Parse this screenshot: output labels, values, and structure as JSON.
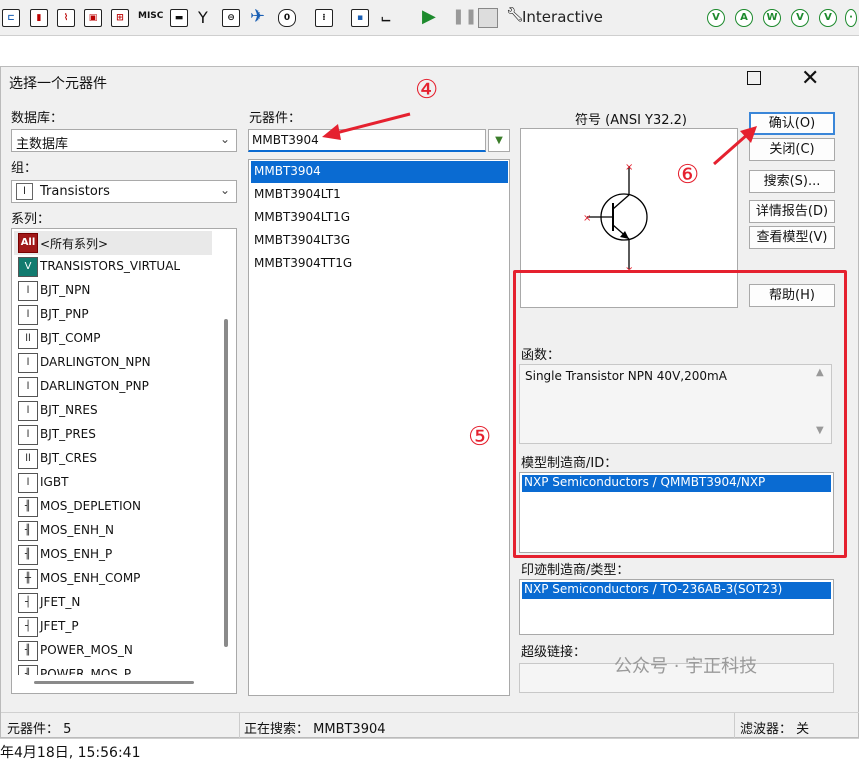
{
  "toolbar": {
    "icons": [
      "switch-icon",
      "chip-icon",
      "misc-icon",
      "transistor-icon",
      "play-icon",
      "pause-icon",
      "stop-icon",
      "probe-icon"
    ],
    "misc_label": "MISC",
    "interactive_label": "Interactive"
  },
  "dialog": {
    "title": "选择一个元器件",
    "database_label": "数据库：",
    "database_value": "主数据库",
    "group_label": "组：",
    "group_value": "Transistors",
    "family_label": "系列：",
    "families": [
      {
        "label": "<所有系列>",
        "icon": "All"
      },
      {
        "label": "TRANSISTORS_VIRTUAL",
        "icon": "V"
      },
      {
        "label": "BJT_NPN",
        "icon": "npn"
      },
      {
        "label": "BJT_PNP",
        "icon": "pnp"
      },
      {
        "label": "BJT_COMP",
        "icon": "cmp"
      },
      {
        "label": "DARLINGTON_NPN",
        "icon": "dn"
      },
      {
        "label": "DARLINGTON_PNP",
        "icon": "dp"
      },
      {
        "label": "BJT_NRES",
        "icon": "nr"
      },
      {
        "label": "BJT_PRES",
        "icon": "pr"
      },
      {
        "label": "BJT_CRES",
        "icon": "cr"
      },
      {
        "label": "IGBT",
        "icon": "ig"
      },
      {
        "label": "MOS_DEPLETION",
        "icon": "md"
      },
      {
        "label": "MOS_ENH_N",
        "icon": "mn"
      },
      {
        "label": "MOS_ENH_P",
        "icon": "mp"
      },
      {
        "label": "MOS_ENH_COMP",
        "icon": "mc"
      },
      {
        "label": "JFET_N",
        "icon": "jn"
      },
      {
        "label": "JFET_P",
        "icon": "jp"
      },
      {
        "label": "POWER_MOS_N",
        "icon": "pn"
      },
      {
        "label": "POWER_MOS_P",
        "icon": "pp"
      }
    ],
    "component_label": "元器件：",
    "component_value": "MMBT3904",
    "components": [
      "MMBT3904",
      "MMBT3904LT1",
      "MMBT3904LT1G",
      "MMBT3904LT3G",
      "MMBT3904TT1G"
    ],
    "symbol_label": "符号 (ANSI Y32.2)",
    "buttons": {
      "ok": "确认(O)",
      "close": "关闭(C)",
      "search": "搜索(S)...",
      "detail": "详情报告(D)",
      "model": "查看模型(V)",
      "help": "帮助(H)"
    },
    "function_label": "函数：",
    "function_value": "Single Transistor NPN 40V,200mA",
    "model_mfr_label": "模型制造商/ID：",
    "model_mfr_value": "NXP Semiconductors / QMMBT3904/NXP",
    "footprint_label": "印迹制造商/类型：",
    "footprint_value": "NXP Semiconductors / TO-236AB-3(SOT23)",
    "hyperlink_label": "超级链接：",
    "status": {
      "count": "元器件：  5",
      "searching": "正在搜索：  MMBT3904",
      "filter": "滤波器：  关"
    }
  },
  "annotations": {
    "a4": "④",
    "a5": "⑤",
    "a6": "⑥"
  },
  "watermark": "公众号 · 宇正科技",
  "timestamp": "年4月18日, 15:56:41",
  "colors": {
    "selection": "#0a6bd2",
    "annotation_red": "#e5212f",
    "default_button_border": "#3a86d8"
  }
}
